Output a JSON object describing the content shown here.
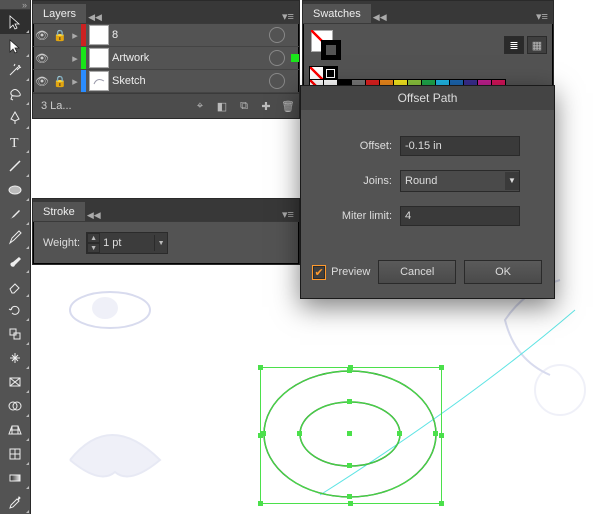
{
  "layers": {
    "tab": "Layers",
    "rows": [
      {
        "name": "8",
        "strip": "#cc2222",
        "locked": true,
        "thumb": "blank"
      },
      {
        "name": "Artwork",
        "strip": "#19e619",
        "locked": false,
        "thumb": "blank",
        "selected": true
      },
      {
        "name": "Sketch",
        "strip": "#2a8cff",
        "locked": true,
        "thumb": "sketch"
      }
    ],
    "footer_count": "3 La...",
    "footer_icons": [
      "locate-layer",
      "new-sublayer",
      "new-layer",
      "trash"
    ]
  },
  "stroke": {
    "tab": "Stroke",
    "weight_label": "Weight:",
    "weight_value": "1 pt"
  },
  "swatches": {
    "tab": "Swatches",
    "colors_row": [
      "#ffffff",
      "#000000",
      "#787878",
      "#e0201f",
      "#f08a1c",
      "#f7e81e",
      "#8cc63e",
      "#1fa84c",
      "#20b9e8",
      "#1c67b1",
      "#3a2e8f",
      "#c02090",
      "#d4145a"
    ]
  },
  "dialog": {
    "title": "Offset Path",
    "offset_label": "Offset:",
    "offset_value": "-0.15 in",
    "joins_label": "Joins:",
    "joins_value": "Round",
    "miter_label": "Miter limit:",
    "miter_value": "4",
    "preview_label": "Preview",
    "preview_checked": true,
    "cancel_label": "Cancel",
    "ok_label": "OK"
  },
  "tools": [
    "selection-tool",
    "direct-selection-tool",
    "magic-wand-tool",
    "lasso-tool",
    "pen-tool",
    "type-tool",
    "line-tool",
    "rectangle-tool",
    "paintbrush-tool",
    "pencil-tool",
    "blob-brush-tool",
    "eraser-tool",
    "rotate-tool",
    "scale-tool",
    "width-tool",
    "free-transform-tool",
    "shape-builder-tool",
    "perspective-grid-tool",
    "mesh-tool",
    "gradient-tool",
    "eyedropper-tool"
  ]
}
